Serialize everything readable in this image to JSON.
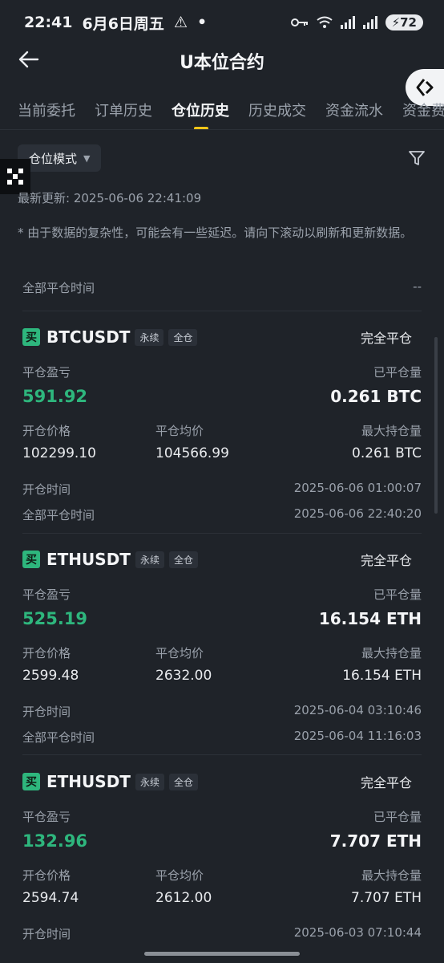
{
  "status_bar": {
    "time": "22:41",
    "date": "6月6日周五",
    "warning_icon": "⚠",
    "dot": "•",
    "battery": "72"
  },
  "header": {
    "title": "U本位合约"
  },
  "float_button": {
    "icon": "share-arrows-icon"
  },
  "tabs": [
    {
      "label": "当前委托"
    },
    {
      "label": "订单历史"
    },
    {
      "label": "仓位历史"
    },
    {
      "label": "历史成交"
    },
    {
      "label": "资金流水"
    },
    {
      "label": "资金费"
    }
  ],
  "filters": {
    "mode_label": "仓位模式"
  },
  "last_updated": "最新更新: 2025-06-06 22:41:09",
  "note": "* 由于数据的复杂性，可能会有一些延迟。请向下滚动以刷新和更新数据。",
  "close_all_time": {
    "label": "全部平仓时间",
    "value": "--"
  },
  "labels": {
    "pnl": "平仓盈亏",
    "closed_qty": "已平仓量",
    "open_price": "开仓价格",
    "close_avg": "平仓均价",
    "max_pos": "最大持仓量",
    "open_time": "开仓时间",
    "close_all_time": "全部平仓时间"
  },
  "positions": [
    {
      "side": "买",
      "symbol": "BTCUSDT",
      "tag1": "永续",
      "tag2": "全仓",
      "status": "完全平仓",
      "pnl": "591.92",
      "closed_qty": "0.261 BTC",
      "open_price": "102299.10",
      "close_avg": "104566.99",
      "max_pos": "0.261 BTC",
      "open_time": "2025-06-06 01:00:07",
      "close_all_time": "2025-06-06 22:40:20"
    },
    {
      "side": "买",
      "symbol": "ETHUSDT",
      "tag1": "永续",
      "tag2": "全仓",
      "status": "完全平仓",
      "pnl": "525.19",
      "closed_qty": "16.154 ETH",
      "open_price": "2599.48",
      "close_avg": "2632.00",
      "max_pos": "16.154 ETH",
      "open_time": "2025-06-04 03:10:46",
      "close_all_time": "2025-06-04 11:16:03"
    },
    {
      "side": "买",
      "symbol": "ETHUSDT",
      "tag1": "永续",
      "tag2": "全仓",
      "status": "完全平仓",
      "pnl": "132.96",
      "closed_qty": "7.707 ETH",
      "open_price": "2594.74",
      "close_avg": "2612.00",
      "max_pos": "7.707 ETH",
      "open_time": "2025-06-03 07:10:44"
    }
  ],
  "colors": {
    "background": "#1f2329",
    "profit": "#2eb67d",
    "accent": "#f5c518"
  }
}
